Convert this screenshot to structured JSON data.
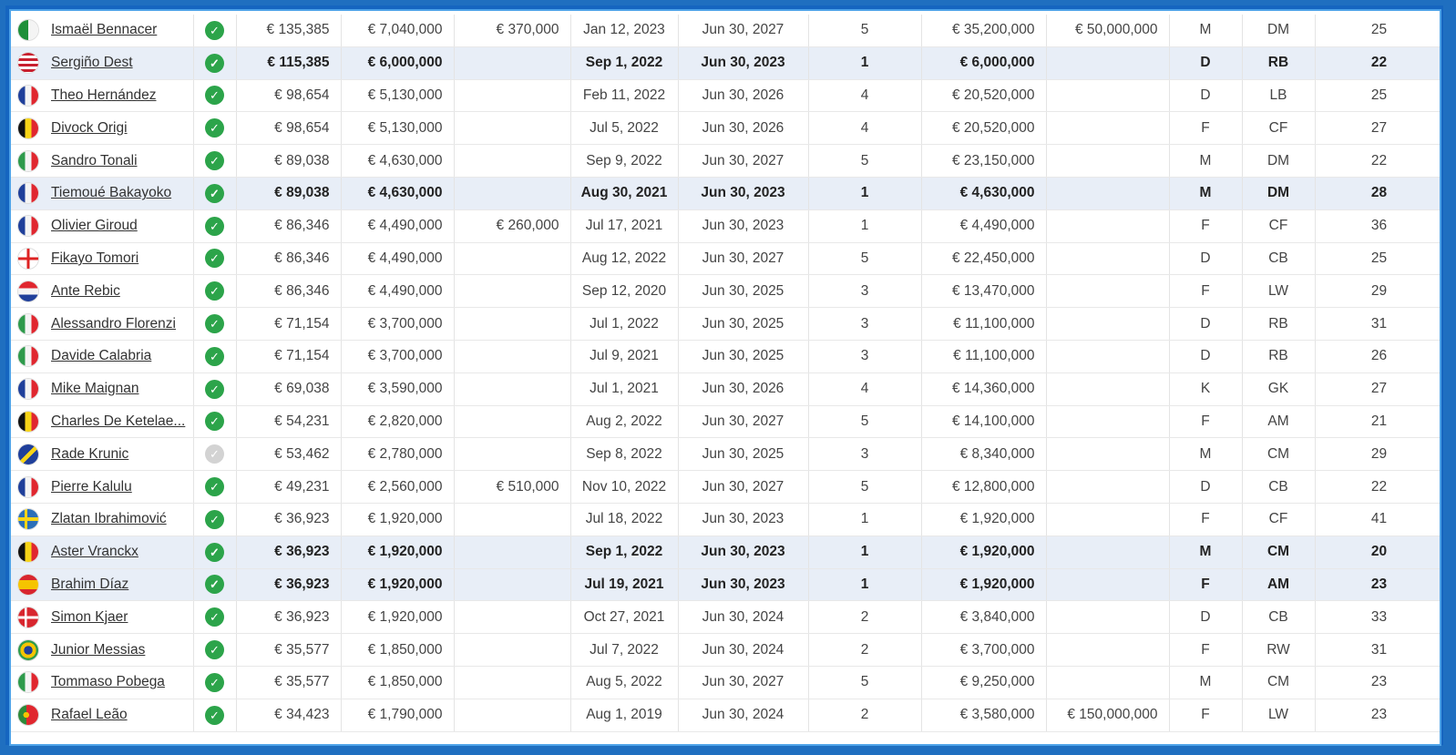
{
  "columns": [
    "player",
    "status",
    "weekly",
    "yearly",
    "bonus",
    "signed",
    "expiration",
    "years",
    "total",
    "release",
    "pos",
    "detail",
    "age"
  ],
  "colors": {
    "accent": "#1565c0",
    "highlight": "#e8eef7",
    "check": "#2ca44a"
  },
  "rows": [
    {
      "name": "Ismaël Bennacer",
      "flag": "algeria-flag",
      "status": true,
      "weekly": "€ 135,385",
      "yearly": "€ 7,040,000",
      "bonus": "€ 370,000",
      "signed": "Jan 12, 2023",
      "expiration": "Jun 30, 2027",
      "years": "5",
      "total": "€ 35,200,000",
      "release": "€ 50,000,000",
      "pos": "M",
      "detail": "DM",
      "age": "25",
      "highlight": false
    },
    {
      "name": "Sergiño Dest",
      "flag": "usa-flag",
      "status": true,
      "weekly": "€ 115,385",
      "yearly": "€ 6,000,000",
      "bonus": "",
      "signed": "Sep 1, 2022",
      "expiration": "Jun 30, 2023",
      "years": "1",
      "total": "€ 6,000,000",
      "release": "",
      "pos": "D",
      "detail": "RB",
      "age": "22",
      "highlight": true
    },
    {
      "name": "Theo Hernández",
      "flag": "france-flag",
      "status": true,
      "weekly": "€ 98,654",
      "yearly": "€ 5,130,000",
      "bonus": "",
      "signed": "Feb 11, 2022",
      "expiration": "Jun 30, 2026",
      "years": "4",
      "total": "€ 20,520,000",
      "release": "",
      "pos": "D",
      "detail": "LB",
      "age": "25",
      "highlight": false
    },
    {
      "name": "Divock Origi",
      "flag": "belgium-flag",
      "status": true,
      "weekly": "€ 98,654",
      "yearly": "€ 5,130,000",
      "bonus": "",
      "signed": "Jul 5, 2022",
      "expiration": "Jun 30, 2026",
      "years": "4",
      "total": "€ 20,520,000",
      "release": "",
      "pos": "F",
      "detail": "CF",
      "age": "27",
      "highlight": false
    },
    {
      "name": "Sandro Tonali",
      "flag": "italy-flag",
      "status": true,
      "weekly": "€ 89,038",
      "yearly": "€ 4,630,000",
      "bonus": "",
      "signed": "Sep 9, 2022",
      "expiration": "Jun 30, 2027",
      "years": "5",
      "total": "€ 23,150,000",
      "release": "",
      "pos": "M",
      "detail": "DM",
      "age": "22",
      "highlight": false
    },
    {
      "name": "Tiemoué Bakayoko",
      "flag": "france-flag",
      "status": true,
      "weekly": "€ 89,038",
      "yearly": "€ 4,630,000",
      "bonus": "",
      "signed": "Aug 30, 2021",
      "expiration": "Jun 30, 2023",
      "years": "1",
      "total": "€ 4,630,000",
      "release": "",
      "pos": "M",
      "detail": "DM",
      "age": "28",
      "highlight": true
    },
    {
      "name": "Olivier Giroud",
      "flag": "france-flag",
      "status": true,
      "weekly": "€ 86,346",
      "yearly": "€ 4,490,000",
      "bonus": "€ 260,000",
      "signed": "Jul 17, 2021",
      "expiration": "Jun 30, 2023",
      "years": "1",
      "total": "€ 4,490,000",
      "release": "",
      "pos": "F",
      "detail": "CF",
      "age": "36",
      "highlight": false
    },
    {
      "name": "Fikayo Tomori",
      "flag": "england-flag",
      "status": true,
      "weekly": "€ 86,346",
      "yearly": "€ 4,490,000",
      "bonus": "",
      "signed": "Aug 12, 2022",
      "expiration": "Jun 30, 2027",
      "years": "5",
      "total": "€ 22,450,000",
      "release": "",
      "pos": "D",
      "detail": "CB",
      "age": "25",
      "highlight": false
    },
    {
      "name": "Ante Rebic",
      "flag": "croatia-flag",
      "status": true,
      "weekly": "€ 86,346",
      "yearly": "€ 4,490,000",
      "bonus": "",
      "signed": "Sep 12, 2020",
      "expiration": "Jun 30, 2025",
      "years": "3",
      "total": "€ 13,470,000",
      "release": "",
      "pos": "F",
      "detail": "LW",
      "age": "29",
      "highlight": false
    },
    {
      "name": "Alessandro Florenzi",
      "flag": "italy-flag",
      "status": true,
      "weekly": "€ 71,154",
      "yearly": "€ 3,700,000",
      "bonus": "",
      "signed": "Jul 1, 2022",
      "expiration": "Jun 30, 2025",
      "years": "3",
      "total": "€ 11,100,000",
      "release": "",
      "pos": "D",
      "detail": "RB",
      "age": "31",
      "highlight": false
    },
    {
      "name": "Davide Calabria",
      "flag": "italy-flag",
      "status": true,
      "weekly": "€ 71,154",
      "yearly": "€ 3,700,000",
      "bonus": "",
      "signed": "Jul 9, 2021",
      "expiration": "Jun 30, 2025",
      "years": "3",
      "total": "€ 11,100,000",
      "release": "",
      "pos": "D",
      "detail": "RB",
      "age": "26",
      "highlight": false
    },
    {
      "name": "Mike Maignan",
      "flag": "france-flag",
      "status": true,
      "weekly": "€ 69,038",
      "yearly": "€ 3,590,000",
      "bonus": "",
      "signed": "Jul 1, 2021",
      "expiration": "Jun 30, 2026",
      "years": "4",
      "total": "€ 14,360,000",
      "release": "",
      "pos": "K",
      "detail": "GK",
      "age": "27",
      "highlight": false
    },
    {
      "name": "Charles De Ketelae...",
      "flag": "belgium-flag",
      "status": true,
      "weekly": "€ 54,231",
      "yearly": "€ 2,820,000",
      "bonus": "",
      "signed": "Aug 2, 2022",
      "expiration": "Jun 30, 2027",
      "years": "5",
      "total": "€ 14,100,000",
      "release": "",
      "pos": "F",
      "detail": "AM",
      "age": "21",
      "highlight": false
    },
    {
      "name": "Rade Krunic",
      "flag": "bosnia-flag",
      "status": false,
      "weekly": "€ 53,462",
      "yearly": "€ 2,780,000",
      "bonus": "",
      "signed": "Sep 8, 2022",
      "expiration": "Jun 30, 2025",
      "years": "3",
      "total": "€ 8,340,000",
      "release": "",
      "pos": "M",
      "detail": "CM",
      "age": "29",
      "highlight": false
    },
    {
      "name": "Pierre Kalulu",
      "flag": "france-flag",
      "status": true,
      "weekly": "€ 49,231",
      "yearly": "€ 2,560,000",
      "bonus": "€ 510,000",
      "signed": "Nov 10, 2022",
      "expiration": "Jun 30, 2027",
      "years": "5",
      "total": "€ 12,800,000",
      "release": "",
      "pos": "D",
      "detail": "CB",
      "age": "22",
      "highlight": false
    },
    {
      "name": "Zlatan Ibrahimović",
      "flag": "sweden-flag",
      "status": true,
      "weekly": "€ 36,923",
      "yearly": "€ 1,920,000",
      "bonus": "",
      "signed": "Jul 18, 2022",
      "expiration": "Jun 30, 2023",
      "years": "1",
      "total": "€ 1,920,000",
      "release": "",
      "pos": "F",
      "detail": "CF",
      "age": "41",
      "highlight": false
    },
    {
      "name": "Aster Vranckx",
      "flag": "belgium-flag",
      "status": true,
      "weekly": "€ 36,923",
      "yearly": "€ 1,920,000",
      "bonus": "",
      "signed": "Sep 1, 2022",
      "expiration": "Jun 30, 2023",
      "years": "1",
      "total": "€ 1,920,000",
      "release": "",
      "pos": "M",
      "detail": "CM",
      "age": "20",
      "highlight": true
    },
    {
      "name": "Brahim Díaz",
      "flag": "spain-flag",
      "status": true,
      "weekly": "€ 36,923",
      "yearly": "€ 1,920,000",
      "bonus": "",
      "signed": "Jul 19, 2021",
      "expiration": "Jun 30, 2023",
      "years": "1",
      "total": "€ 1,920,000",
      "release": "",
      "pos": "F",
      "detail": "AM",
      "age": "23",
      "highlight": true
    },
    {
      "name": "Simon Kjaer",
      "flag": "denmark-flag",
      "status": true,
      "weekly": "€ 36,923",
      "yearly": "€ 1,920,000",
      "bonus": "",
      "signed": "Oct 27, 2021",
      "expiration": "Jun 30, 2024",
      "years": "2",
      "total": "€ 3,840,000",
      "release": "",
      "pos": "D",
      "detail": "CB",
      "age": "33",
      "highlight": false
    },
    {
      "name": "Junior Messias",
      "flag": "brazil-flag",
      "status": true,
      "weekly": "€ 35,577",
      "yearly": "€ 1,850,000",
      "bonus": "",
      "signed": "Jul 7, 2022",
      "expiration": "Jun 30, 2024",
      "years": "2",
      "total": "€ 3,700,000",
      "release": "",
      "pos": "F",
      "detail": "RW",
      "age": "31",
      "highlight": false
    },
    {
      "name": "Tommaso Pobega",
      "flag": "italy-flag",
      "status": true,
      "weekly": "€ 35,577",
      "yearly": "€ 1,850,000",
      "bonus": "",
      "signed": "Aug 5, 2022",
      "expiration": "Jun 30, 2027",
      "years": "5",
      "total": "€ 9,250,000",
      "release": "",
      "pos": "M",
      "detail": "CM",
      "age": "23",
      "highlight": false
    },
    {
      "name": "Rafael Leão",
      "flag": "portugal-flag",
      "status": true,
      "weekly": "€ 34,423",
      "yearly": "€ 1,790,000",
      "bonus": "",
      "signed": "Aug 1, 2019",
      "expiration": "Jun 30, 2024",
      "years": "2",
      "total": "€ 3,580,000",
      "release": "€ 150,000,000",
      "pos": "F",
      "detail": "LW",
      "age": "23",
      "highlight": false
    }
  ]
}
